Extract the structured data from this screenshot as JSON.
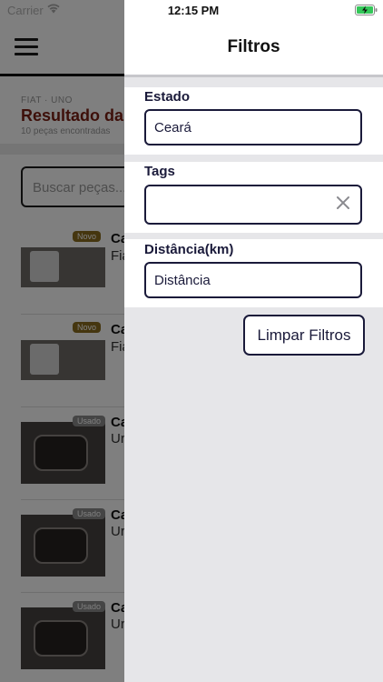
{
  "status_bar": {
    "carrier": "Carrier",
    "time": "12:15 PM"
  },
  "background": {
    "breadcrumb": "FIAT · UNO",
    "results_title": "Resultado da",
    "results_count": "10 peças encontradas",
    "search_placeholder": "Buscar peças...",
    "items": [
      {
        "badge": "Novo",
        "title": "Ca",
        "subtitle": "Fia"
      },
      {
        "badge": "Novo",
        "title": "Ca",
        "subtitle": "Fia"
      },
      {
        "badge": "Usado",
        "title": "Ca",
        "subtitle": "Ur"
      },
      {
        "badge": "Usado",
        "title": "Ca",
        "subtitle": "Ur"
      },
      {
        "badge": "Usado",
        "title": "Ca",
        "subtitle": "Ur"
      }
    ]
  },
  "filters": {
    "title": "Filtros",
    "estado": {
      "label": "Estado",
      "value": "Ceará"
    },
    "tags": {
      "label": "Tags",
      "value": ""
    },
    "distancia": {
      "label": "Distância(km)",
      "placeholder": "Distância"
    },
    "clear_button": "Limpar Filtros"
  },
  "colors": {
    "accent": "#1a1a3a",
    "title_red": "#7a1f12",
    "panel_bg": "#e6e6e9"
  },
  "icons": {
    "menu": "hamburger-icon",
    "wifi": "wifi-icon",
    "battery": "battery-charging-icon",
    "clear": "close-icon"
  }
}
